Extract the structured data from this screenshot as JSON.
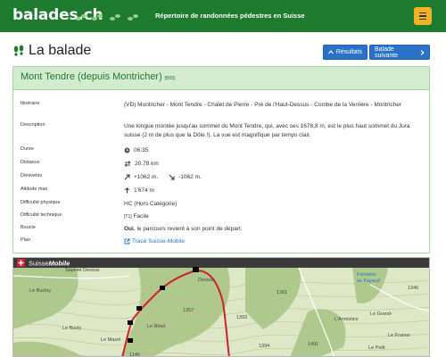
{
  "header": {
    "brand": "balades.ch",
    "tagline": "Répertoire de randonnées pédestres en Suisse",
    "menu_icon": "hamburger-icon",
    "bg_color": "#1e7a2e",
    "menu_color": "#f0b323"
  },
  "page": {
    "title": "La balade",
    "results_button": "Résultats",
    "next_button": "Balade suivante"
  },
  "walk": {
    "name": "Mont Tendre (depuis Montricher)",
    "code": "[B05]",
    "rows": {
      "itineraire": {
        "label": "Itinéraire",
        "value": "(VD) Montricher - Mont Tendre - Chalet de Pierre - Pré de l'Haut-Dessus - Combe de la Verrière - Montricher"
      },
      "description": {
        "label": "Description",
        "value": "Une longue montée jusqu'au sommet du Mont Tendre, qui, avec ses 1678,8 m, est le plus haut sommet du Jura suisse (2 m de plus que la Dôle !). La vue est magnifique par temps clair."
      },
      "duree": {
        "label": "Durée",
        "value": "06:35"
      },
      "distance": {
        "label": "Distance",
        "value": "20.78 km"
      },
      "denivele": {
        "label": "Dénivelés",
        "up": "+1062 m.",
        "down": "-1062 m."
      },
      "altitude": {
        "label": "Altitude max",
        "value": "1'674 m"
      },
      "diff_phys": {
        "label": "Difficulté physique",
        "value": "HC (Hors Catégorie)"
      },
      "diff_tech": {
        "label": "Difficulté technique",
        "tag": "[T1]",
        "value": "Facile"
      },
      "boucle": {
        "label": "Boucle",
        "strong": "Oui",
        "value": ", le parcours revient à son point de départ."
      },
      "plan": {
        "label": "Plan",
        "value": "Tracé Suisse-Mobile"
      }
    }
  },
  "map": {
    "brand_a": "Suisse",
    "brand_b": "Mobile",
    "place_labels": [
      "Sapelet Dessus",
      "Dessus",
      "Le Bucley",
      "Le Rîsel",
      "Le Grand-",
      "L'Armistice",
      "Fontaine",
      "au Fayaud",
      "Le Mazel",
      "Le Bucly",
      "Le Petit",
      "Le Franoz",
      "1146",
      "1393",
      "1357",
      "1381",
      "1394",
      "1491",
      "1346"
    ]
  }
}
